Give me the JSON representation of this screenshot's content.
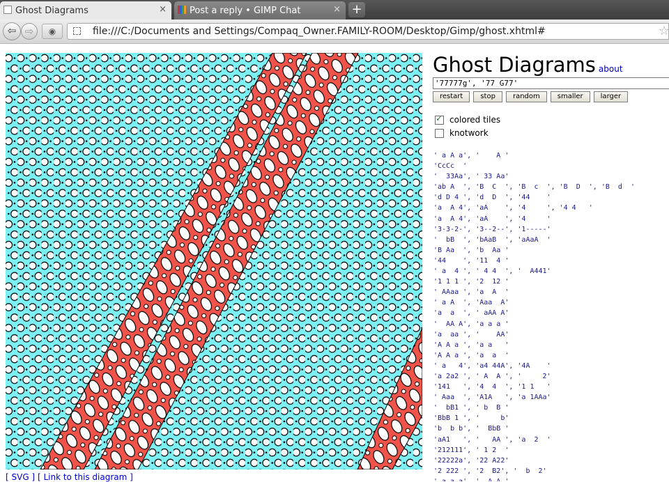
{
  "browser": {
    "tabs": [
      {
        "label": "Ghost Diagrams",
        "active": true
      },
      {
        "label": "Post a reply • GIMP Chat",
        "active": false
      }
    ],
    "new_tab_label": "+",
    "close_glyph": "×",
    "url": "file:///C:/Documents and Settings/Compaq_Owner.FAMILY-ROOM/Desktop/Gimp/ghost.xhtml#"
  },
  "page": {
    "title": "Ghost Diagrams",
    "about_link": "about",
    "code_value": "'77777g', '77 G77'",
    "buttons": {
      "restart": "restart",
      "stop": "stop",
      "random": "random",
      "smaller": "smaller",
      "larger": "larger"
    },
    "options": {
      "colored_tiles": {
        "label": "colored tiles",
        "checked": true
      },
      "knotwork": {
        "label": "knotwork",
        "checked": false
      }
    },
    "links": {
      "svg": "[ SVG ]",
      "diagram": "[ Link to this diagram ]"
    },
    "patterns": [
      "' a A a', '    A '",
      "'CcCc  '",
      "'  33Aa', ' 33 Aa'",
      "'ab A  ', 'B  C  ', 'B  c  ', 'B  D  ', 'B  d  '",
      "'d D 4 ', 'd  D  ', '44    '",
      "'a  A 4', 'aA    ', '4     ', '4 4   '",
      "'a  A 4', 'aA    ', '4     '",
      "'3-3-2-', '3--2--', '1-----'",
      "'  bB  ', 'bAaB  ', 'aAaA  '",
      "'B Aa  ', 'b  Aa '",
      "'44    ', '11  4 '",
      "' a  4 ', ' 4 4  ', '  A441'",
      "'1 1 1 ', '2  12 '",
      "' AAaa ', 'a  A  '",
      "' a A  ', 'Aaa  A'",
      "'a  a  ', ' aAA A'",
      "'  AA A', 'a a a '",
      "'a  aa ', '    AA'",
      "'A A a ', 'a a   '",
      "'A A a ', 'a  a  '",
      "' a   4', 'a4 44A', '4A    '",
      "'a 2a2 ', ' A  A ', '     2'",
      "'141   ', '4  4  ', '1 1   '",
      "' Aaa  ', 'A1A   ', 'a 1AAa'",
      "'  bB1 ', ' b  B '",
      "'BbB 1 ', '     b'",
      "'b  b b', '  BbB '",
      "'aA1   ', '   AA ', 'a  2  '",
      "'212111', ' 1 2  '",
      "'22222a', '22 A22'",
      "'2 222 ', '2  B2', '  b  2'",
      "' a a a', '  A A '"
    ]
  },
  "colors": {
    "background": "#7df0f3",
    "band": "#f0534a",
    "ring_fill": "#ffffff",
    "outline": "#000000",
    "link": "#0000cc",
    "pattern_text": "#1a1a8a"
  }
}
